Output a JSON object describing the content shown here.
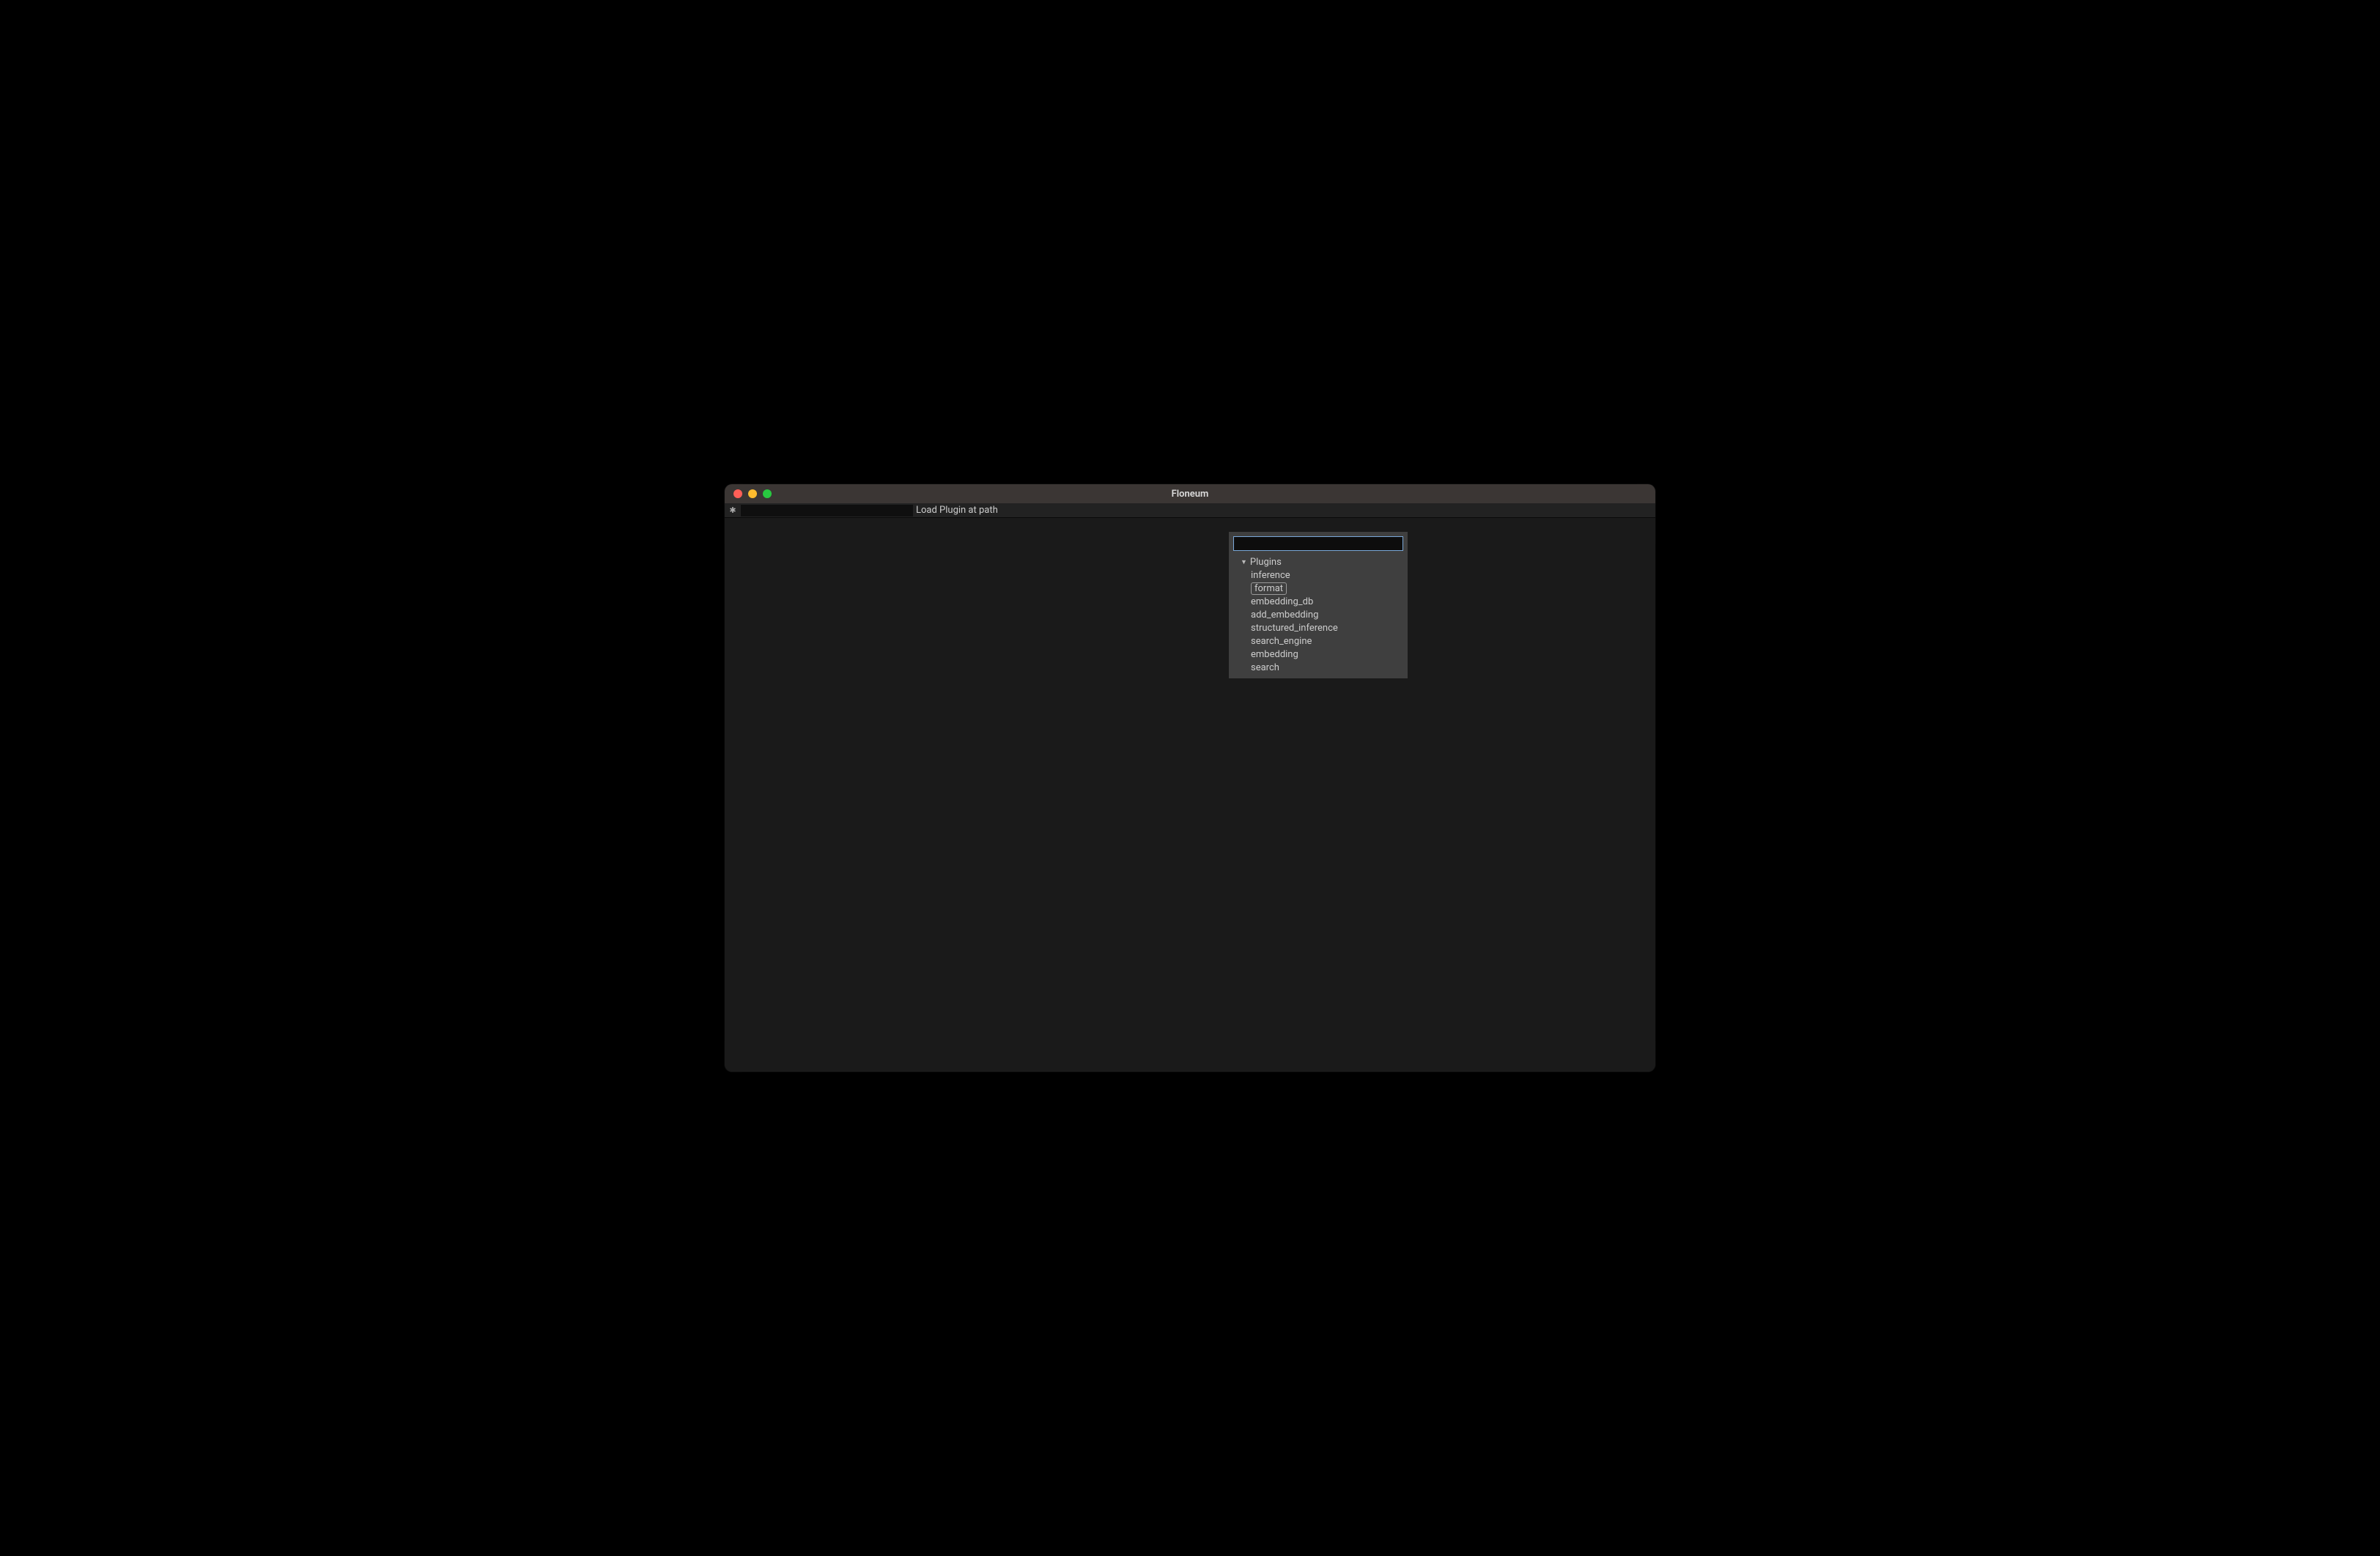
{
  "window": {
    "title": "Floneum"
  },
  "toolbar": {
    "icon_glyph": "✱",
    "path_value": "",
    "load_label": "Load Plugin at path"
  },
  "popup": {
    "search_value": "",
    "header_label": "Plugins",
    "items": [
      {
        "label": "inference",
        "selected": false
      },
      {
        "label": "format",
        "selected": true
      },
      {
        "label": "embedding_db",
        "selected": false
      },
      {
        "label": "add_embedding",
        "selected": false
      },
      {
        "label": "structured_inference",
        "selected": false
      },
      {
        "label": "search_engine",
        "selected": false
      },
      {
        "label": "embedding",
        "selected": false
      },
      {
        "label": "search",
        "selected": false
      }
    ]
  }
}
